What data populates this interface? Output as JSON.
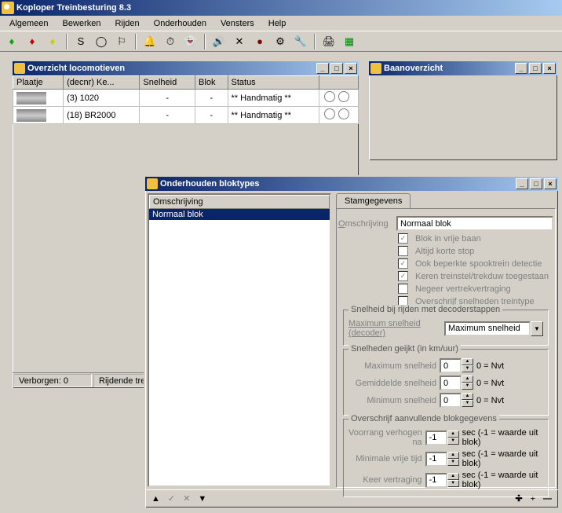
{
  "app": {
    "title": "Koploper Treinbesturing 8.3"
  },
  "menu": [
    "Algemeen",
    "Bewerken",
    "Rijden",
    "Onderhouden",
    "Vensters",
    "Help"
  ],
  "windows": {
    "loco": {
      "title": "Overzicht locomotieven",
      "cols": [
        "Plaatje",
        "(decnr) Ke...",
        "Snelheid",
        "Blok",
        "Status"
      ],
      "rows": [
        {
          "name": "(3) 1020",
          "speed": "-",
          "block": "-",
          "status": "** Handmatig **"
        },
        {
          "name": "(18) BR2000",
          "speed": "-",
          "block": "-",
          "status": "** Handmatig **"
        }
      ],
      "status": {
        "hidden": "Verborgen: 0",
        "riding": "Rijdende tre"
      }
    },
    "baan": {
      "title": "Baanoverzicht"
    },
    "blok": {
      "title": "Onderhouden bloktypes",
      "list_header": "Omschrijving",
      "list_item": "Normaal blok",
      "tab": "Stamgegevens",
      "desc_label": "Omschrijving",
      "desc_value": "Normaal blok",
      "checks": [
        {
          "label": "Blok in vrije baan",
          "checked": true,
          "u": "B"
        },
        {
          "label": "Altijd korte stop",
          "checked": false,
          "u": "k"
        },
        {
          "label": "Ook beperkte spooktrein detectie",
          "checked": true,
          "u": "O"
        },
        {
          "label": "Keren treinstel/trekduw toegestaan",
          "checked": true,
          "u": "K"
        },
        {
          "label": "Negeer vertrekvertraging",
          "checked": false,
          "u": "N"
        },
        {
          "label": "Overschrijf snelheden treintype",
          "checked": false,
          "u": "v"
        }
      ],
      "grp_decoder": {
        "title": "Snelheid bij rijden met decoderstappen",
        "label": "Maximum snelheid (decoder)",
        "value": "Maximum snelheid"
      },
      "grp_speeds": {
        "title": "Snelheden geijkt (in km/uur)",
        "rows": [
          {
            "label": "Maximum snelheid",
            "val": "0",
            "suffix": "0 = Nvt"
          },
          {
            "label": "Gemiddelde snelheid",
            "val": "0",
            "suffix": "0 = Nvt"
          },
          {
            "label": "Minimum snelheid",
            "val": "0",
            "suffix": "0 = Nvt"
          }
        ]
      },
      "grp_extra": {
        "title": "Overschrijf aanvullende blokgegevens",
        "rows": [
          {
            "label": "Voorrang verhogen na",
            "val": "-1",
            "suffix": "sec (-1 = waarde uit blok)"
          },
          {
            "label": "Minimale vrije tijd",
            "val": "-1",
            "suffix": "sec (-1 = waarde uit blok)"
          },
          {
            "label": "Keer vertraging",
            "val": "-1",
            "suffix": "sec (-1 = waarde uit blok)"
          }
        ]
      }
    }
  }
}
